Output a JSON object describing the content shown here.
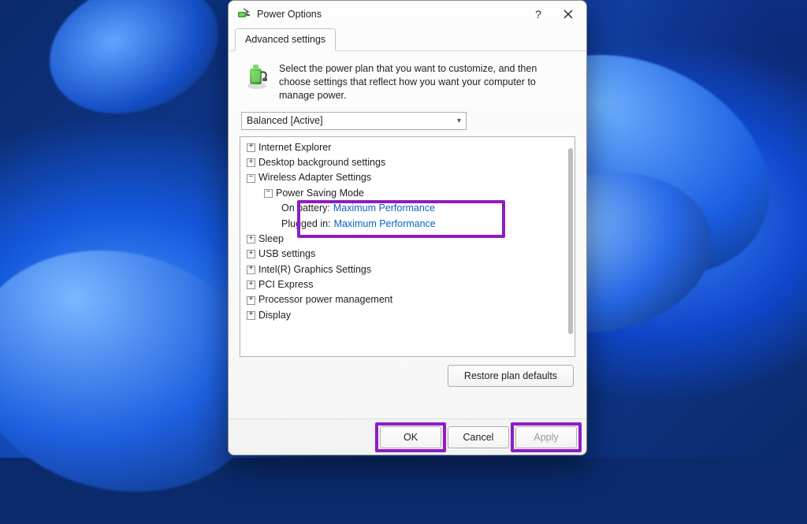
{
  "window": {
    "title": "Power Options"
  },
  "tabs": {
    "advanced": "Advanced settings"
  },
  "intro": {
    "text": "Select the power plan that you want to customize, and then choose settings that reflect how you want your computer to manage power."
  },
  "plan_selector": {
    "value": "Balanced [Active]"
  },
  "tree": {
    "items": [
      {
        "label": "Internet Explorer",
        "expanded": false,
        "level": 0
      },
      {
        "label": "Desktop background settings",
        "expanded": false,
        "level": 0
      },
      {
        "label": "Wireless Adapter Settings",
        "expanded": true,
        "level": 0
      },
      {
        "label": "Power Saving Mode",
        "expanded": true,
        "level": 1
      },
      {
        "label_key": "On battery:",
        "value": "Maximum Performance",
        "level": 2
      },
      {
        "label_key": "Plugged in:",
        "value": "Maximum Performance",
        "level": 2
      },
      {
        "label": "Sleep",
        "expanded": false,
        "level": 0
      },
      {
        "label": "USB settings",
        "expanded": false,
        "level": 0
      },
      {
        "label": "Intel(R) Graphics Settings",
        "expanded": false,
        "level": 0
      },
      {
        "label": "PCI Express",
        "expanded": false,
        "level": 0
      },
      {
        "label": "Processor power management",
        "expanded": false,
        "level": 0
      },
      {
        "label": "Display",
        "expanded": false,
        "level": 0
      }
    ]
  },
  "buttons": {
    "restore": "Restore plan defaults",
    "ok": "OK",
    "cancel": "Cancel",
    "apply": "Apply"
  },
  "highlight_color": "#8e1cc5"
}
